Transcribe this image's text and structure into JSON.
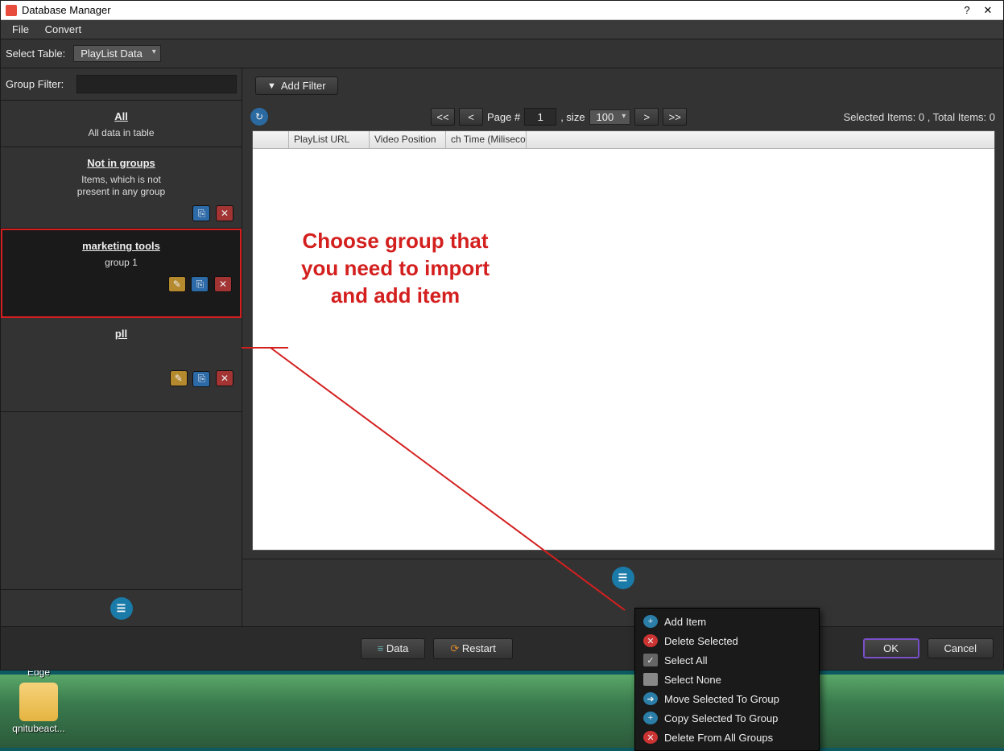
{
  "titlebar": {
    "title": "Database Manager",
    "help": "?",
    "close": "✕"
  },
  "menubar": {
    "file": "File",
    "convert": "Convert"
  },
  "selectbar": {
    "label": "Select Table:",
    "value": "PlayList Data"
  },
  "sidebar": {
    "group_filter_label": "Group Filter:",
    "group_filter_value": "",
    "groups": {
      "all_title": "All",
      "all_sub": "All data in table",
      "notin_title": "Not in groups",
      "notin_sub1": "Items, which is not",
      "notin_sub2": "present in any group",
      "g1_title": "marketing tools",
      "g1_sub": "group 1",
      "g2_title": "pll"
    }
  },
  "filterbar": {
    "add_filter": "Add Filter"
  },
  "pager": {
    "first": "<<",
    "prev": "<",
    "page_label": "Page #",
    "page_value": "1",
    "size_label": ", size",
    "size_value": "100",
    "next": ">",
    "last": ">>",
    "status": "Selected Items:  0  , Total Items:  0"
  },
  "table": {
    "headers": {
      "h0": "",
      "h1": "PlayList URL",
      "h2": "Video Position",
      "h3": "ch Time (Milisecond"
    }
  },
  "annotation": {
    "l1": "Choose group that",
    "l2": "you need to import",
    "l3": "and add item"
  },
  "bottombar": {
    "data": "Data",
    "restart": "Restart",
    "ok": "OK",
    "cancel": "Cancel"
  },
  "context": {
    "add_item": "Add Item",
    "delete_selected": "Delete Selected",
    "select_all": "Select All",
    "select_none": "Select None",
    "move_to_group": "Move Selected To Group",
    "copy_to_group": "Copy Selected To Group",
    "delete_from_all": "Delete From All Groups"
  },
  "desktop": {
    "edge": "Microsoft Edge",
    "folder": "qnitubeact..."
  }
}
